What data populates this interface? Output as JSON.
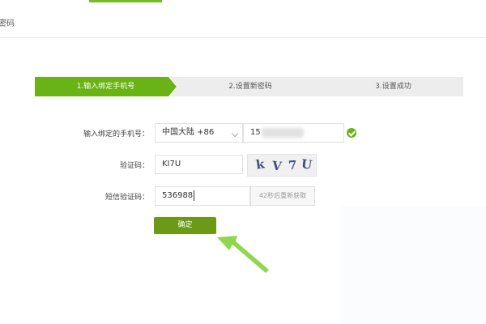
{
  "top_bar": {
    "title": "密码"
  },
  "steps": [
    {
      "label": "1.输入绑定手机号",
      "active": true
    },
    {
      "label": "2.设置新密码",
      "active": false
    },
    {
      "label": "3.设置成功",
      "active": false
    }
  ],
  "form": {
    "phone_label": "输入绑定的手机号：",
    "country_value": "中国大陆 +86",
    "phone_value": "15",
    "captcha_label": "验证码：",
    "captcha_value": "KI7U",
    "captcha_image_text": [
      "k",
      "V",
      "7",
      "U"
    ],
    "sms_label": "短信验证码：",
    "sms_value": "536988",
    "resend_label": "42秒后重新获取",
    "confirm_label": "确定"
  },
  "colors": {
    "accent": "#6ab316",
    "button": "#6a9a16",
    "arrow": "#86d23a"
  },
  "icons": [
    "chevron-down-icon",
    "check-circle-icon",
    "arrow-pointer-icon"
  ]
}
